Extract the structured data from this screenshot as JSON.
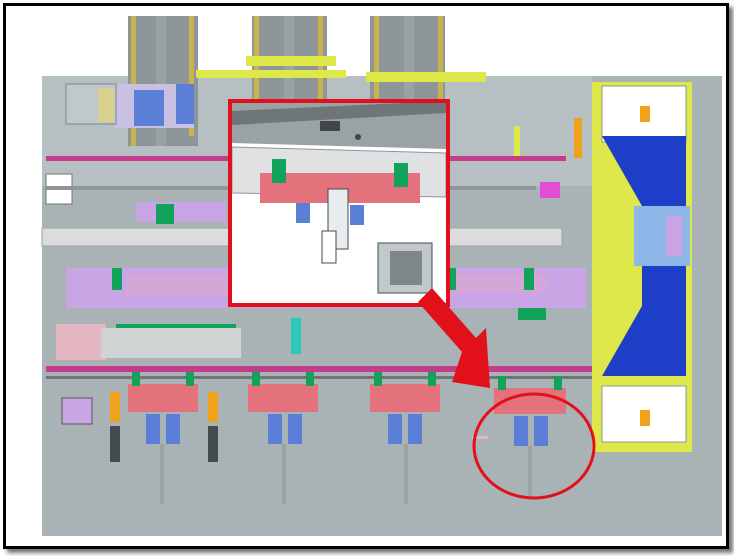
{
  "figure": {
    "description_text": "",
    "colors": {
      "floor": "#a9b3b6",
      "conveyor_rail": "#c63c8a",
      "gripper_body": "#e3727d",
      "clamp_green": "#11a35a",
      "cylinder_blue": "#5b7fd6",
      "highlight_red": "#e2101a",
      "platform_blue": "#1d3fc7",
      "accent_yellow": "#dfe84a",
      "accent_orange": "#f0a21c",
      "frame_lilac": "#c9a5e6"
    },
    "stations": [
      "station-1",
      "station-2",
      "station-3",
      "station-4"
    ],
    "highlight": {
      "shape": "circle",
      "color": "#e2101a",
      "target": "station-4"
    }
  }
}
